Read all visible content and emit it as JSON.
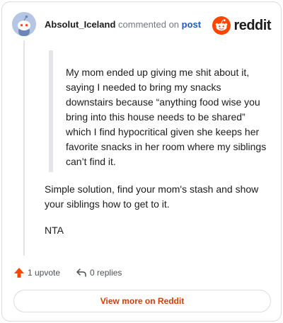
{
  "comment": {
    "username": "Absolut_Iceland",
    "action_text": "commented on",
    "target_link": "post",
    "quote": "My mom ended up giving me shit about it, saying I needed to bring my snacks downstairs because “anything food wise you bring into this house needs to be shared” which I find hypocritical given she keeps her favorite snacks in her room where my siblings can’t find it.",
    "paragraphs": [
      "Simple solution, find your mom's stash and show your siblings how to get to it.",
      "NTA"
    ],
    "upvotes_label": "1 upvote",
    "replies_label": "0 replies"
  },
  "brand": {
    "name": "reddit",
    "color": "#ff4500"
  },
  "button": {
    "label": "View more on Reddit"
  },
  "icons": {
    "avatar": "snoo-avatar-icon",
    "logo": "reddit-logo-icon",
    "upvote": "upvote-arrow-icon",
    "reply": "reply-arrow-icon"
  }
}
